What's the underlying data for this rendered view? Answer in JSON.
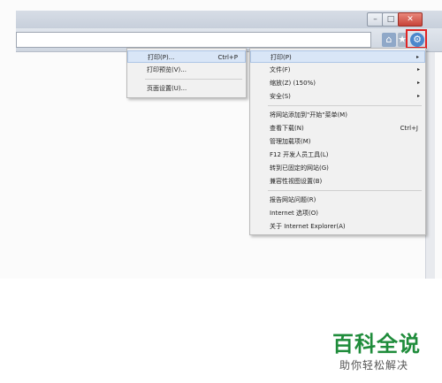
{
  "toolbar": {
    "icons": [
      "home-icon",
      "favorites-icon",
      "gear-icon"
    ]
  },
  "context_menu_left": {
    "items": [
      {
        "label": "打印(P)...",
        "shortcut": "Ctrl+P"
      },
      {
        "label": "打印预览(V)...",
        "shortcut": ""
      },
      {
        "label": "页面设置(U)...",
        "shortcut": ""
      }
    ]
  },
  "context_menu_right": {
    "items": [
      {
        "label": "打印(P)",
        "shortcut": "",
        "submenu": true
      },
      {
        "label": "文件(F)",
        "shortcut": "",
        "submenu": true
      },
      {
        "label": "缩放(Z) (150%)",
        "shortcut": "",
        "submenu": true
      },
      {
        "label": "安全(S)",
        "shortcut": "",
        "submenu": true
      },
      {
        "label": "将网站添加到\"开始\"菜单(M)",
        "shortcut": "",
        "submenu": false
      },
      {
        "label": "查看下载(N)",
        "shortcut": "Ctrl+J",
        "submenu": false
      },
      {
        "label": "管理加载项(M)",
        "shortcut": "",
        "submenu": false
      },
      {
        "label": "F12 开发人员工具(L)",
        "shortcut": "",
        "submenu": false
      },
      {
        "label": "转到已固定的网站(G)",
        "shortcut": "",
        "submenu": false
      },
      {
        "label": "兼容性视图设置(B)",
        "shortcut": "",
        "submenu": false
      },
      {
        "label": "报告网站问题(R)",
        "shortcut": "",
        "submenu": false
      },
      {
        "label": "Internet 选项(O)",
        "shortcut": "",
        "submenu": false
      },
      {
        "label": "关于 Internet Explorer(A)",
        "shortcut": "",
        "submenu": false
      }
    ],
    "submenu_arrow": "▸"
  },
  "watermark": {
    "title": "百科全说",
    "subtitle": "助你轻松解决"
  },
  "colors": {
    "highlight_box": "#e02323",
    "brand_green": "#1f8c3b"
  }
}
